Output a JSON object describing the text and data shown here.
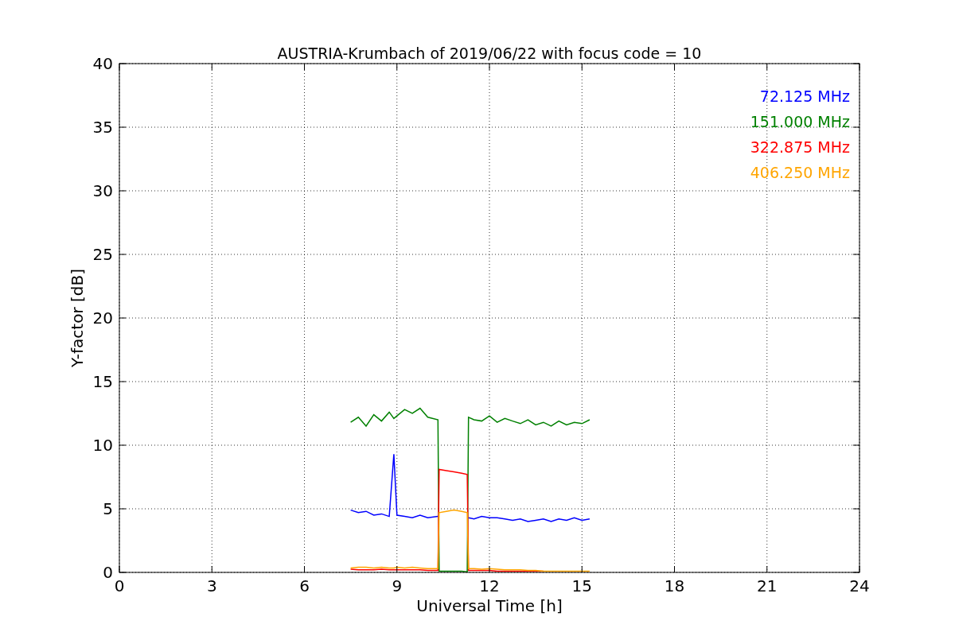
{
  "chart_data": {
    "type": "line",
    "title": "AUSTRIA-Krumbach of 2019/06/22 with focus code = 10",
    "xlabel": "Universal Time [h]",
    "ylabel": "Y-factor [dB]",
    "x": [
      7.5,
      7.75,
      8,
      8.25,
      8.5,
      8.75,
      8.9,
      9,
      9.25,
      9.5,
      9.75,
      10,
      10.33,
      10.37,
      10.6,
      10.85,
      11.1,
      11.28,
      11.32,
      11.5,
      11.75,
      12,
      12.25,
      12.5,
      12.75,
      13,
      13.25,
      13.5,
      13.75,
      14,
      14.25,
      14.5,
      14.75,
      15,
      15.25
    ],
    "series": [
      {
        "name": "72.125 MHz",
        "color": "#0000ff",
        "values": [
          4.9,
          4.7,
          4.8,
          4.5,
          4.6,
          4.4,
          9.3,
          4.5,
          4.4,
          4.3,
          4.5,
          4.3,
          4.4,
          null,
          null,
          null,
          null,
          null,
          4.3,
          4.2,
          4.4,
          4.3,
          4.3,
          4.2,
          4.1,
          4.2,
          4.0,
          4.1,
          4.2,
          4.0,
          4.2,
          4.1,
          4.3,
          4.1,
          4.2
        ]
      },
      {
        "name": "151.000 MHz",
        "color": "#008000",
        "values": [
          11.8,
          12.2,
          11.5,
          12.4,
          11.9,
          12.6,
          12.1,
          12.3,
          12.8,
          12.5,
          12.9,
          12.2,
          12.0,
          0.1,
          0.1,
          0.1,
          0.1,
          0.05,
          12.2,
          12.0,
          11.9,
          12.3,
          11.8,
          12.1,
          11.9,
          11.7,
          12.0,
          11.6,
          11.8,
          11.5,
          11.9,
          11.6,
          11.8,
          11.7,
          12.0
        ]
      },
      {
        "name": "322.875 MHz",
        "color": "#ff0000",
        "values": [
          0.25,
          0.2,
          0.2,
          0.2,
          0.25,
          0.2,
          0.2,
          0.2,
          0.2,
          0.2,
          0.2,
          0.15,
          0.15,
          8.1,
          8.0,
          7.9,
          7.8,
          7.7,
          0.15,
          0.15,
          0.15,
          0.15,
          0.1,
          0.1,
          0.1,
          0.1,
          0.1,
          0.1,
          0.1,
          null,
          null,
          null,
          null,
          null,
          null
        ]
      },
      {
        "name": "406.250 MHz",
        "color": "#ffa500",
        "values": [
          0.35,
          0.4,
          0.4,
          0.35,
          0.4,
          0.35,
          0.35,
          0.4,
          0.35,
          0.4,
          0.35,
          0.3,
          0.3,
          4.7,
          4.8,
          4.9,
          4.8,
          4.7,
          0.3,
          0.3,
          0.25,
          0.3,
          0.25,
          0.2,
          0.2,
          0.2,
          0.15,
          0.15,
          0.1,
          0.1,
          0.1,
          0.1,
          0.1,
          0.1,
          0.1
        ]
      }
    ],
    "grid": true,
    "xlim": [
      0,
      24
    ],
    "ylim": [
      0,
      40
    ],
    "xticks": [
      0,
      3,
      6,
      9,
      12,
      15,
      18,
      21,
      24
    ],
    "yticks": [
      0,
      5,
      10,
      15,
      20,
      25,
      30,
      35,
      40
    ]
  }
}
